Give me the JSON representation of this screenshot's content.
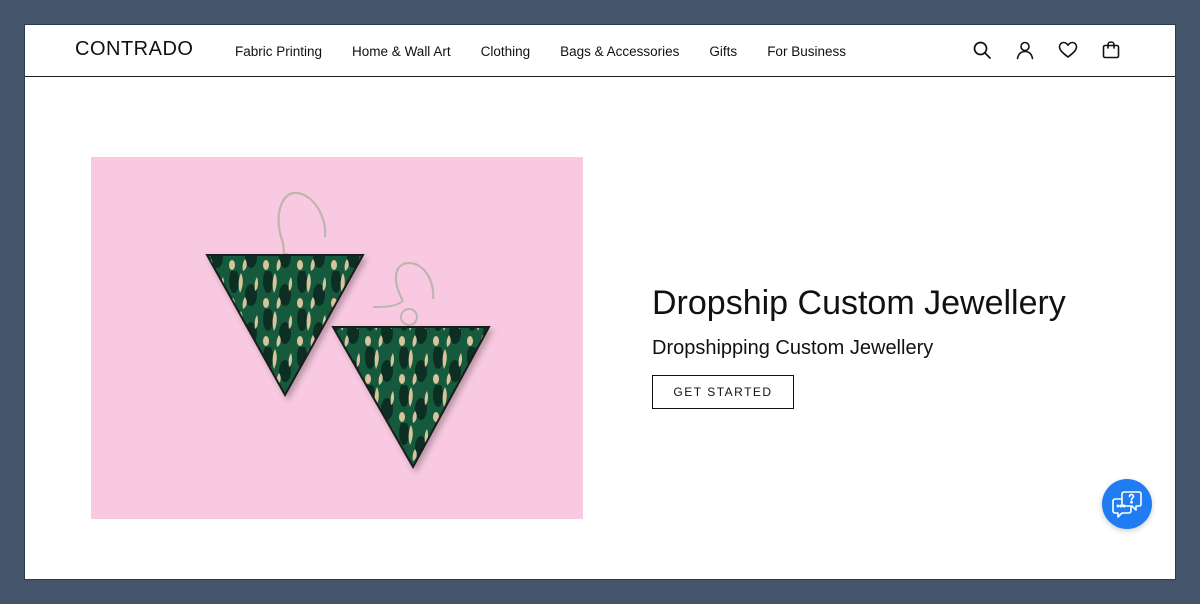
{
  "header": {
    "logo": "CONTRADO",
    "nav": [
      {
        "label": "Fabric Printing"
      },
      {
        "label": "Home & Wall Art"
      },
      {
        "label": "Clothing"
      },
      {
        "label": "Bags & Accessories"
      },
      {
        "label": "Gifts"
      },
      {
        "label": "For Business"
      }
    ],
    "icons": [
      "search-icon",
      "user-icon",
      "heart-icon",
      "shopping-bag-icon"
    ]
  },
  "hero": {
    "title": "Dropship Custom Jewellery",
    "subtitle": "Dropshipping Custom Jewellery",
    "cta_label": "GET STARTED",
    "image_background": "#f8c9e0",
    "image_subject": "triangle-earrings-image"
  },
  "chat": {
    "icon": "chat-help-icon",
    "color": "#1f7cf2"
  },
  "colors": {
    "page_background": "#44546b",
    "text": "#111111",
    "earring_green": "#145a3e",
    "earring_dark": "#0b2e22",
    "earring_tan": "#d9c39a"
  }
}
